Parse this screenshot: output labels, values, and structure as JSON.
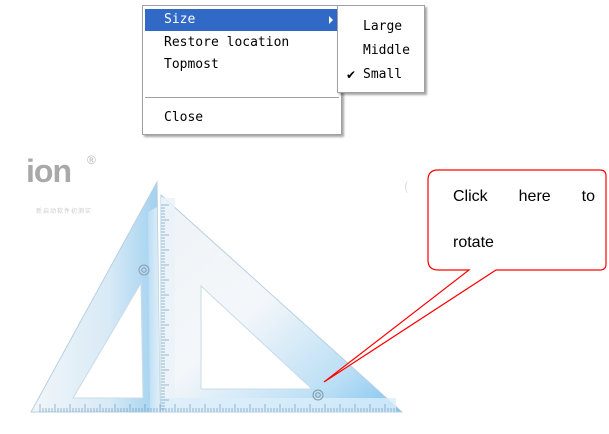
{
  "menu": {
    "items": [
      {
        "label": "Size"
      },
      {
        "label": "Restore location"
      },
      {
        "label": "Topmost"
      },
      {
        "label": "Close"
      }
    ]
  },
  "size_submenu": {
    "items": [
      {
        "label": "Large",
        "checked": false
      },
      {
        "label": "Middle",
        "checked": false
      },
      {
        "label": "Small",
        "checked": true
      }
    ],
    "check_glyph": "✔"
  },
  "background_app": {
    "logo_text": "ion",
    "logo_mark": "®",
    "caption": "新启动软件初测实",
    "brace": "("
  },
  "callout": {
    "words_line1": [
      "Click",
      "here",
      "to"
    ],
    "line2": "rotate"
  },
  "colors": {
    "menu_highlight": "#3169c6",
    "ruler_blue": "#8ec9ee",
    "callout_red": "#ff0000"
  },
  "icons": [
    "submenu-arrow-icon",
    "check-icon",
    "rotate-handle-icon",
    "pivot-hole-icon"
  ]
}
